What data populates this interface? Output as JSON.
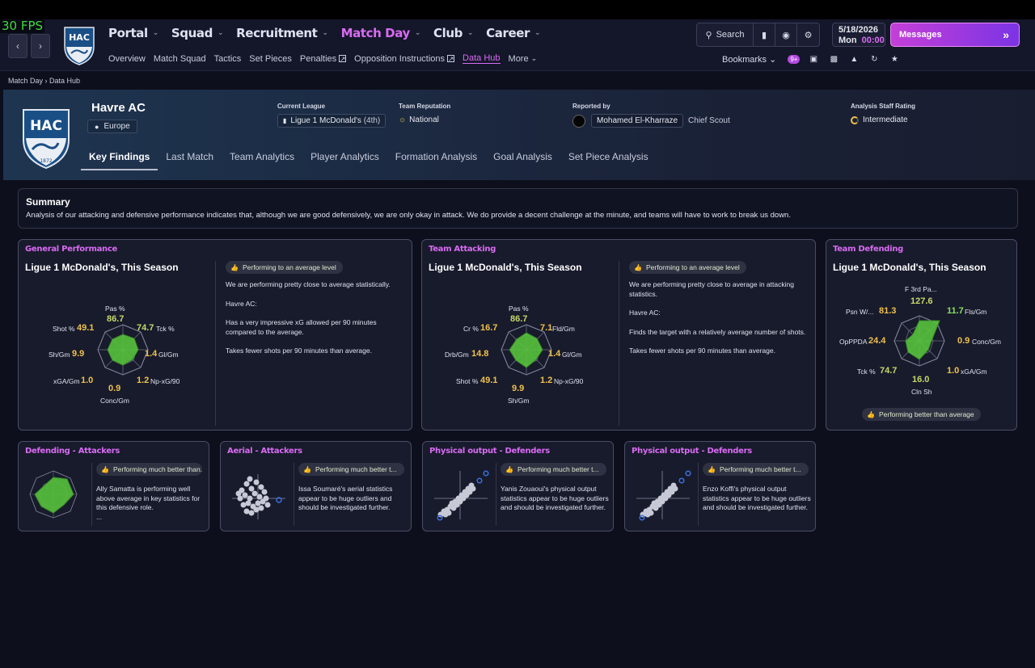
{
  "fps": "30 FPS",
  "nav": {
    "items": [
      {
        "label": "Portal"
      },
      {
        "label": "Squad"
      },
      {
        "label": "Recruitment"
      },
      {
        "label": "Match Day"
      },
      {
        "label": "Club"
      },
      {
        "label": "Career"
      }
    ],
    "sub": [
      "Overview",
      "Match Squad",
      "Tactics",
      "Set Pieces",
      "Penalties",
      "Opposition Instructions",
      "Data Hub",
      "More"
    ]
  },
  "toolbar": {
    "search_label": "Search",
    "date": "5/18/2026",
    "day": "Mon",
    "time": "00:00",
    "messages_label": "Messages",
    "bookmarks_label": "Bookmarks",
    "badge": "9+"
  },
  "breadcrumb": {
    "parent": "Match Day",
    "current": "Data Hub"
  },
  "club": {
    "name": "Havre AC",
    "region": "Europe",
    "logo_text": "HAC",
    "logo_year": "1872",
    "current_league_label": "Current League",
    "current_league": "Ligue 1 McDonald's",
    "league_position": "(4th)",
    "reputation_label": "Team Reputation",
    "reputation": "National",
    "reported_by_label": "Reported by",
    "reporter": "Mohamed El-Kharraze",
    "reporter_role": "Chief Scout",
    "staff_rating_label": "Analysis Staff Rating",
    "staff_rating": "Intermediate"
  },
  "tabs": [
    "Key Findings",
    "Last Match",
    "Team Analytics",
    "Player Analytics",
    "Formation Analysis",
    "Goal Analysis",
    "Set Piece Analysis"
  ],
  "summary": {
    "title": "Summary",
    "text": "Analysis of our attacking and defensive performance indicates that, although we are good defensively, we are only okay in attack. We do provide a decent challenge at the minute, and teams will have to work to break us down."
  },
  "cards": {
    "general": {
      "title": "General Performance",
      "subtitle": "Ligue 1 McDonald's, This Season",
      "pill": "Performing to an average level",
      "text": [
        "We are performing pretty close to average statistically.",
        "Havre AC:",
        "Has a very impressive xG allowed per 90 minutes compared to the average.",
        "Takes fewer shots per 90 minutes than average."
      ],
      "labels": [
        "Pas %",
        "Tck %",
        "Gl/Gm",
        "Np-xG/90",
        "Conc/Gm",
        "xGA/Gm",
        "Sh/Gm",
        "Shot %"
      ],
      "values": [
        "86.7",
        "74.7",
        "1.4",
        "1.2",
        "0.9",
        "1.0",
        "9.9",
        "49.1"
      ]
    },
    "attacking": {
      "title": "Team Attacking",
      "subtitle": "Ligue 1 McDonald's, This Season",
      "pill": "Performing to an average level",
      "text": [
        "We are performing pretty close to average in attacking statistics.",
        "Havre AC:",
        "Finds the target with a relatively average number of shots.",
        "Takes fewer shots per 90 minutes than average."
      ],
      "labels": [
        "Pas %",
        "Fld/Gm",
        "Gl/Gm",
        "Np-xG/90",
        "Sh/Gm",
        "Shot %",
        "Drb/Gm",
        "Cr %"
      ],
      "values": [
        "86.7",
        "7.1",
        "1.4",
        "1.2",
        "9.9",
        "49.1",
        "14.8",
        "16.7"
      ]
    },
    "defending": {
      "title": "Team Defending",
      "subtitle": "Ligue 1 McDonald's, This Season",
      "pill": "Performing better than average",
      "labels": [
        "F 3rd Pa...",
        "Fls/Gm",
        "Conc/Gm",
        "xGA/Gm",
        "Cln Sh",
        "Tck %",
        "OpPPDA",
        "Psn W/..."
      ],
      "values": [
        "127.6",
        "11.7",
        "0.9",
        "1.0",
        "16.0",
        "74.7",
        "24.4",
        "81.3"
      ]
    },
    "small": [
      {
        "title": "Defending - Attackers",
        "pill": "Performing much better than...",
        "text": "Ally Samatta is performing well above average in key statistics for this defensive role.",
        "ellipsis": "..."
      },
      {
        "title": "Aerial - Attackers",
        "pill": "Performing much better t...",
        "text": "Issa Soumaré's aerial statistics appear to be huge outliers and should be investigated further."
      },
      {
        "title": "Physical output - Defenders",
        "pill": "Performing much better t...",
        "text": "Yanis Zouaoui's physical output statistics appear to be huge outliers and should be investigated further."
      },
      {
        "title": "Physical output - Defenders",
        "pill": "Performing much better t...",
        "text": "Enzo Koffi's physical output statistics appear to be huge outliers and should be investigated further."
      }
    ]
  },
  "colors": {
    "accent": "#d96bf2",
    "radar_fill": "#56c23c",
    "value_yellow": "#f0c14a",
    "value_green": "#8ce05a"
  },
  "icons": [
    "chevron-left-icon",
    "chevron-right-icon",
    "search-icon",
    "bookmark-icon",
    "globe-icon",
    "gear-icon",
    "double-chevron-right-icon",
    "location-pin-icon",
    "thumbs-up-icon",
    "external-link-icon"
  ]
}
